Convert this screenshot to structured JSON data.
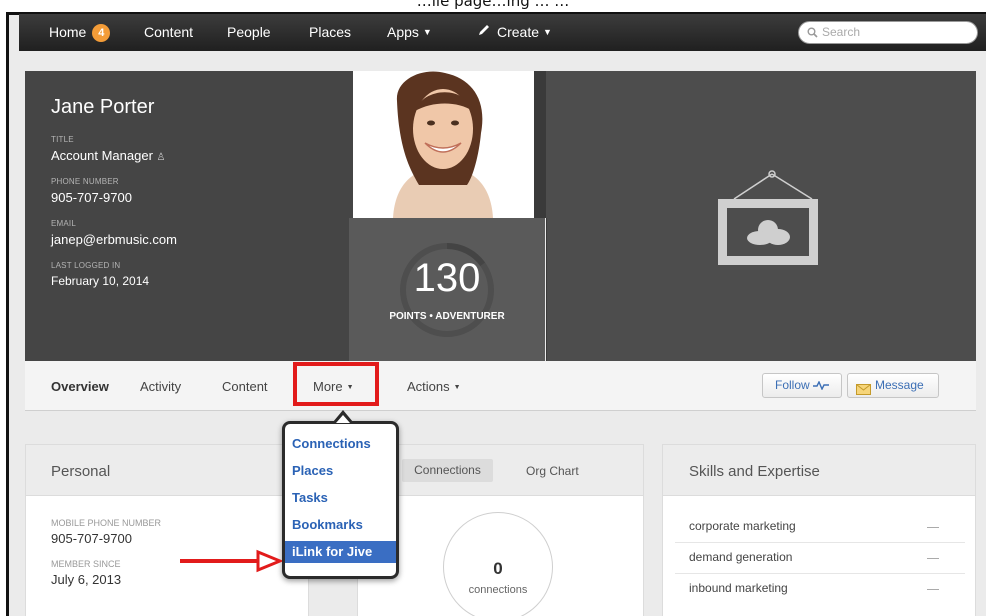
{
  "caption": "…ile page…ing …  …",
  "nav": {
    "home": "Home",
    "home_badge": "4",
    "content": "Content",
    "people": "People",
    "places": "Places",
    "apps": "Apps",
    "create": "Create",
    "search_placeholder": "Search"
  },
  "profile": {
    "name": "Jane Porter",
    "title_label": "TITLE",
    "title": "Account Manager",
    "phone_label": "PHONE NUMBER",
    "phone": "905-707-9700",
    "email_label": "EMAIL",
    "email": "janep@erbmusic.com",
    "last_login_label": "LAST LOGGED IN",
    "last_login": "February 10, 2014",
    "points": "130",
    "points_label": "POINTS • ADVENTURER",
    "points_progress": 0.15
  },
  "tabs": {
    "overview": "Overview",
    "activity": "Activity",
    "content": "Content",
    "more": "More",
    "actions": "Actions"
  },
  "buttons": {
    "follow": "Follow",
    "message": "Message"
  },
  "menu": {
    "items": [
      "Connections",
      "Places",
      "Tasks",
      "Bookmarks",
      "iLink for Jive"
    ],
    "selected_index": 4
  },
  "personal": {
    "title": "Personal",
    "mobile_label": "MOBILE PHONE NUMBER",
    "mobile": "905-707-9700",
    "member_label": "MEMBER SINCE",
    "member_since": "July 6, 2013"
  },
  "connections": {
    "tab_connections": "Connections",
    "tab_orgchart": "Org Chart",
    "count": "0",
    "count_label": "connections"
  },
  "skills": {
    "title": "Skills and Expertise",
    "items": [
      "corporate marketing",
      "demand generation",
      "inbound marketing"
    ]
  },
  "colors": {
    "accent_badge": "#f39c38",
    "highlight_red": "#e21b1b",
    "menu_highlight": "#3a6ec3",
    "link_blue": "#2a62b5"
  }
}
